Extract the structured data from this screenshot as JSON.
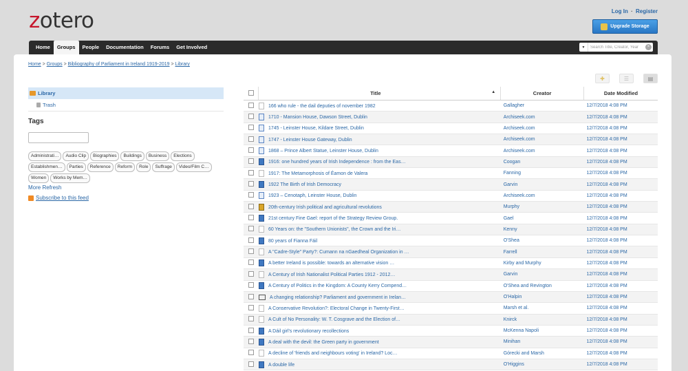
{
  "header": {
    "logo_z": "z",
    "logo_rest": "otero",
    "login": "Log In",
    "sep": "·",
    "register": "Register",
    "upgrade": "Upgrade Storage"
  },
  "nav": {
    "items": [
      "Home",
      "Groups",
      "People",
      "Documentation",
      "Forums",
      "Get Involved"
    ],
    "search_placeholder": "Search Title, Creator, Year"
  },
  "breadcrumb": {
    "home": "Home",
    "groups": "Groups",
    "group": "Bibliography of Parliament in Ireland 1919-2019",
    "library": "Library",
    "sep": ">"
  },
  "sidebar": {
    "library": "Library",
    "trash": "Trash",
    "tags_heading": "Tags",
    "tags": [
      "Administrati…",
      "Audio Clip",
      "Biographies",
      "Buildings",
      "Business",
      "Elections",
      "Establishmen…",
      "Parties",
      "Reference",
      "Reform",
      "Role",
      "Suffrage",
      "Video/Film C…",
      "Women",
      "Works by Mem…"
    ],
    "more": "More",
    "refresh": "Refresh",
    "subscribe": "Subscribe to this feed"
  },
  "table": {
    "headers": {
      "title": "Title",
      "creator": "Creator",
      "date": "Date Modified"
    },
    "sort_indicator": "▲",
    "rows": [
      {
        "icon": "doc",
        "title": "166 who rule - the dail deputies of november 1982",
        "creator": "Gallagher",
        "date": "12/7/2018 4:08 PM"
      },
      {
        "icon": "web",
        "title": "1710 - Mansion House, Dawson Street, Dublin",
        "creator": "Archiseek.com",
        "date": "12/7/2018 4:08 PM"
      },
      {
        "icon": "web",
        "title": "1745 - Leinster House, Kildare Street, Dublin",
        "creator": "Archiseek.com",
        "date": "12/7/2018 4:08 PM"
      },
      {
        "icon": "web",
        "title": "1747 - Leinster House Gateway, Dublin",
        "creator": "Archiseek.com",
        "date": "12/7/2018 4:08 PM"
      },
      {
        "icon": "web",
        "title": "1868 – Prince Albert Statue, Leinster House, Dublin",
        "creator": "Archiseek.com",
        "date": "12/7/2018 4:08 PM"
      },
      {
        "icon": "book",
        "title": "1916: one hundred years of Irish Independence : from the Eas…",
        "creator": "Coogan",
        "date": "12/7/2018 4:08 PM"
      },
      {
        "icon": "doc",
        "title": "1917: The Metamorphosis of Éamon de Valera",
        "creator": "Fanning",
        "date": "12/7/2018 4:08 PM"
      },
      {
        "icon": "book",
        "title": "1922 The Birth of Irish Democracy",
        "creator": "Garvin",
        "date": "12/7/2018 4:08 PM"
      },
      {
        "icon": "web",
        "title": "1923 – Cenotaph, Leinster House, Dublin",
        "creator": "Archiseek.com",
        "date": "12/7/2018 4:08 PM"
      },
      {
        "icon": "multi",
        "title": "20th-century Irish political and agricultural revolutions",
        "creator": "Murphy",
        "date": "12/7/2018 4:08 PM"
      },
      {
        "icon": "book",
        "title": "21st century Fine Gael: report of the Strategy Review Group.",
        "creator": "Gael",
        "date": "12/7/2018 4:08 PM"
      },
      {
        "icon": "doc",
        "title": "60 Years on: the \"Southern Unionists\", the Crown and the Iri…",
        "creator": "Kenny",
        "date": "12/7/2018 4:08 PM"
      },
      {
        "icon": "book",
        "title": "80 years of Fianna Fáil",
        "creator": "O'Shea",
        "date": "12/7/2018 4:08 PM"
      },
      {
        "icon": "doc",
        "title": "A \"Cadre-Style\" Party?: Cumann na nGaedheal Organization in …",
        "creator": "Farrell",
        "date": "12/7/2018 4:08 PM"
      },
      {
        "icon": "book",
        "title": "A better Ireland is possible: towards an alternative vision …",
        "creator": "Kirby and Murphy",
        "date": "12/7/2018 4:08 PM"
      },
      {
        "icon": "doc",
        "title": "A Century of Irish Nationalist Political Parties 1912 - 2012…",
        "creator": "Garvin",
        "date": "12/7/2018 4:08 PM"
      },
      {
        "icon": "book",
        "title": "A Century of Politics in the Kingdom: A County Kerry Compend…",
        "creator": "O'Shea and Revington",
        "date": "12/7/2018 4:08 PM"
      },
      {
        "icon": "open",
        "title": "A changing relationship? Parliament and government in Irelan…",
        "creator": "O'Halpin",
        "date": "12/7/2018 4:08 PM"
      },
      {
        "icon": "doc",
        "title": "A Conservative Revolution?: Electoral Change in Twenty-First…",
        "creator": "Marsh et al.",
        "date": "12/7/2018 4:08 PM"
      },
      {
        "icon": "doc",
        "title": "A Cult of No Personality: W. T. Cosgrave and the Election of…",
        "creator": "Knirck",
        "date": "12/7/2018 4:08 PM"
      },
      {
        "icon": "book",
        "title": "A Dáil girl's revolutionary recollections",
        "creator": "McKenna Napoli",
        "date": "12/7/2018 4:08 PM"
      },
      {
        "icon": "book",
        "title": "A deal with the devil: the Green party in government",
        "creator": "Minihan",
        "date": "12/7/2018 4:08 PM"
      },
      {
        "icon": "doc",
        "title": "A decline of 'friends and neighbours voting' in Ireland? Loc…",
        "creator": "Górecki and Marsh",
        "date": "12/7/2018 4:08 PM"
      },
      {
        "icon": "book",
        "title": "A double life",
        "creator": "O'Higgins",
        "date": "12/7/2018 4:08 PM"
      }
    ]
  }
}
